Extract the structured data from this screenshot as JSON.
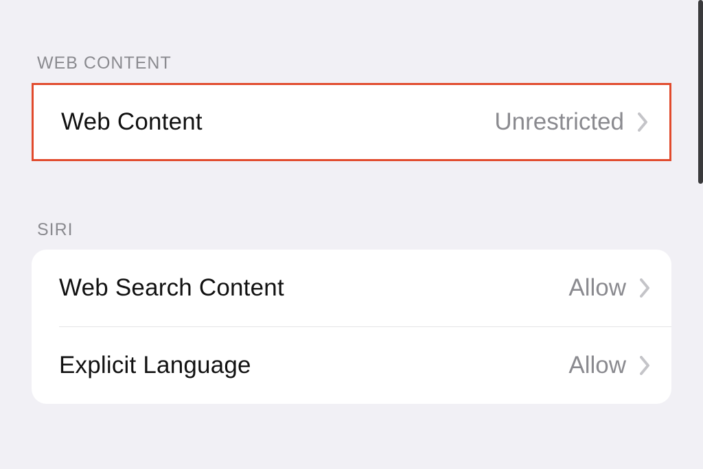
{
  "sections": {
    "web_content": {
      "header": "WEB CONTENT",
      "rows": [
        {
          "label": "Web Content",
          "value": "Unrestricted"
        }
      ]
    },
    "siri": {
      "header": "SIRI",
      "rows": [
        {
          "label": "Web Search Content",
          "value": "Allow"
        },
        {
          "label": "Explicit Language",
          "value": "Allow"
        }
      ]
    }
  },
  "colors": {
    "highlight_border": "#e14a2c",
    "background": "#f1f0f5",
    "row_background": "#ffffff",
    "secondary_text": "#8a8a8f"
  }
}
